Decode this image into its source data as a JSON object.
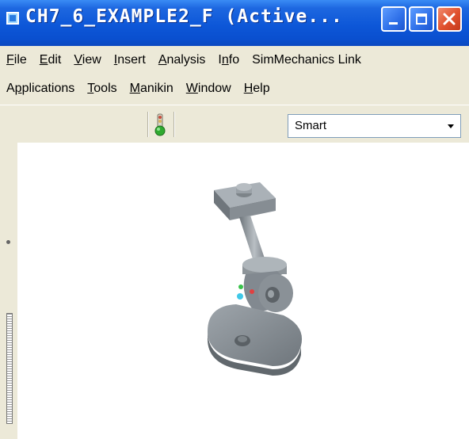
{
  "window": {
    "title": "CH7_6_EXAMPLE2_F (Active..."
  },
  "menus": {
    "row1": [
      {
        "label": "File",
        "underline": "F"
      },
      {
        "label": "Edit",
        "underline": "E"
      },
      {
        "label": "View",
        "underline": "V"
      },
      {
        "label": "Insert",
        "underline": "I"
      },
      {
        "label": "Analysis",
        "underline": "A"
      },
      {
        "label": "Info",
        "underline": "n"
      },
      {
        "label": "SimMechanics Link",
        "underline": ""
      }
    ],
    "row2": [
      {
        "label": "Applications",
        "underline": "p"
      },
      {
        "label": "Tools",
        "underline": "T"
      },
      {
        "label": "Manikin",
        "underline": "M"
      },
      {
        "label": "Window",
        "underline": "W"
      },
      {
        "label": "Help",
        "underline": "H"
      }
    ]
  },
  "toolbar": {
    "filter_value": "Smart",
    "status_icon": "traffic-light-icon"
  },
  "colors": {
    "titlebar": "#0d57d8",
    "chrome": "#ece9d8",
    "model": "#8f969c"
  }
}
